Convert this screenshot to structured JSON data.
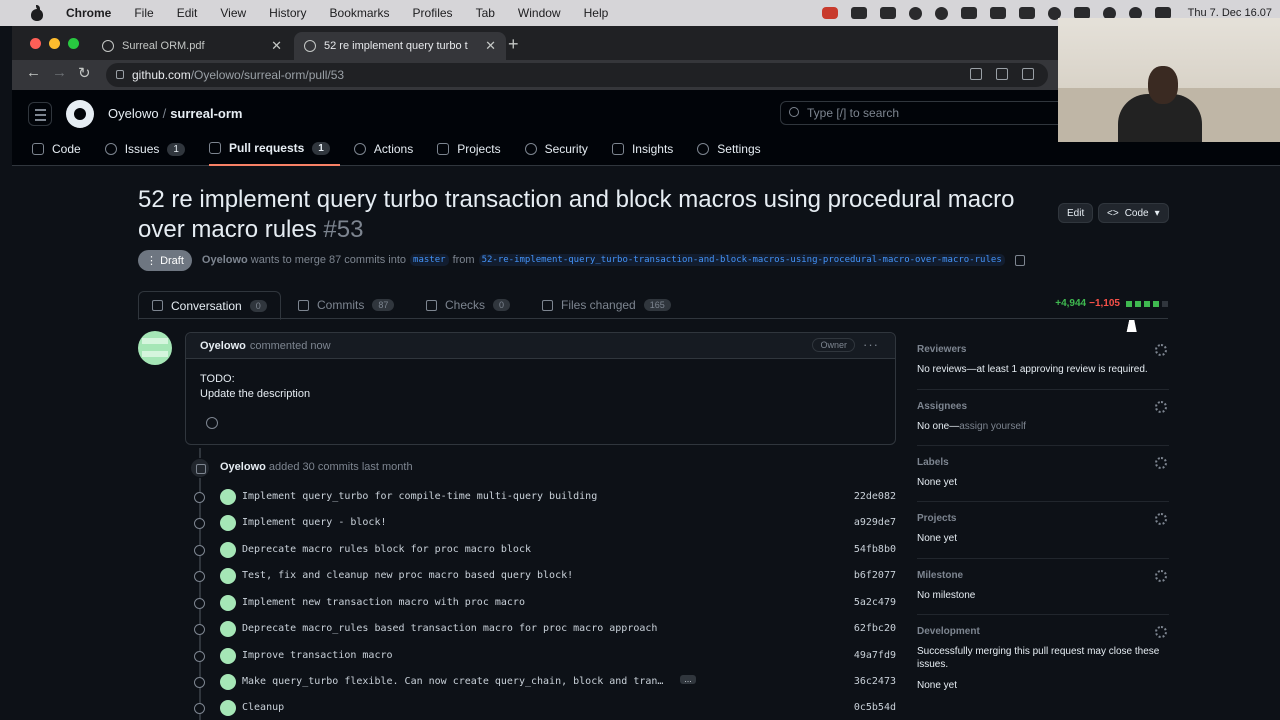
{
  "menubar": {
    "app": "Chrome",
    "items": [
      "File",
      "Edit",
      "View",
      "History",
      "Bookmarks",
      "Profiles",
      "Tab",
      "Window",
      "Help"
    ],
    "clock": "Thu 7. Dec 16.07"
  },
  "browser": {
    "tabs": [
      {
        "title": "Surreal ORM.pdf"
      },
      {
        "title": "52 re implement query turbo t"
      }
    ],
    "url_host": "github.com",
    "url_path": "/Oyelowo/surreal-orm/pull/53"
  },
  "github": {
    "owner": "Oyelowo",
    "repo": "surreal-orm",
    "search_placeholder": "Type [/] to search",
    "nav": [
      {
        "label": "Code",
        "count": ""
      },
      {
        "label": "Issues",
        "count": "1"
      },
      {
        "label": "Pull requests",
        "count": "1"
      },
      {
        "label": "Actions",
        "count": ""
      },
      {
        "label": "Projects",
        "count": ""
      },
      {
        "label": "Security",
        "count": ""
      },
      {
        "label": "Insights",
        "count": ""
      },
      {
        "label": "Settings",
        "count": ""
      }
    ]
  },
  "pr": {
    "title": "52 re implement query turbo transaction and block macros using procedural macro over macro rules",
    "number": "#53",
    "edit_label": "Edit",
    "code_label": "Code",
    "status": "Draft",
    "author": "Oyelowo",
    "merge_text": "wants to merge 87 commits into",
    "base_branch": "master",
    "from_text": "from",
    "head_branch": "52-re-implement-query_turbo-transaction-and-block-macros-using-procedural-macro-over-macro-rules",
    "tabs": [
      {
        "label": "Conversation",
        "count": "0"
      },
      {
        "label": "Commits",
        "count": "87"
      },
      {
        "label": "Checks",
        "count": "0"
      },
      {
        "label": "Files changed",
        "count": "165"
      }
    ],
    "additions": "+4,944",
    "deletions": "−1,105",
    "colors": {
      "add": "#3fb950",
      "del": "#f85149",
      "accent": "#f78166",
      "link": "#4493f8"
    }
  },
  "comment": {
    "author": "Oyelowo",
    "time": "commented now",
    "badge": "Owner",
    "line1": "TODO:",
    "line2": "Update the description"
  },
  "timeline": {
    "actor": "Oyelowo",
    "event": "added 30 commits last month",
    "commits": [
      {
        "msg": "Implement query_turbo for compile-time multi-query building",
        "sha": "22de082"
      },
      {
        "msg": "Implement query - block!",
        "sha": "a929de7"
      },
      {
        "msg": "Deprecate macro rules block for proc macro block",
        "sha": "54fb8b0"
      },
      {
        "msg": "Test, fix and cleanup new proc macro based query block!",
        "sha": "b6f2077"
      },
      {
        "msg": "Implement new transaction macro with proc macro",
        "sha": "5a2c479"
      },
      {
        "msg": "Deprecate macro_rules based transaction macro for proc macro approach",
        "sha": "62fbc20"
      },
      {
        "msg": "Improve transaction macro",
        "sha": "49a7fd9"
      },
      {
        "msg": "Make query_turbo flexible. Can now create query_chain, block and tran…",
        "sha": "36c2473"
      },
      {
        "msg": "Cleanup",
        "sha": "0c5b54d"
      }
    ],
    "more_label": "…"
  },
  "sidebar": {
    "reviewers": {
      "label": "Reviewers",
      "value": "No reviews—at least 1 approving review is required."
    },
    "assignees": {
      "label": "Assignees",
      "value": "No one—",
      "link": "assign yourself"
    },
    "labels": {
      "label": "Labels",
      "value": "None yet"
    },
    "projects": {
      "label": "Projects",
      "value": "None yet"
    },
    "milestone": {
      "label": "Milestone",
      "value": "No milestone"
    },
    "development": {
      "label": "Development",
      "value": "Successfully merging this pull request may close these issues.",
      "value2": "None yet"
    }
  }
}
